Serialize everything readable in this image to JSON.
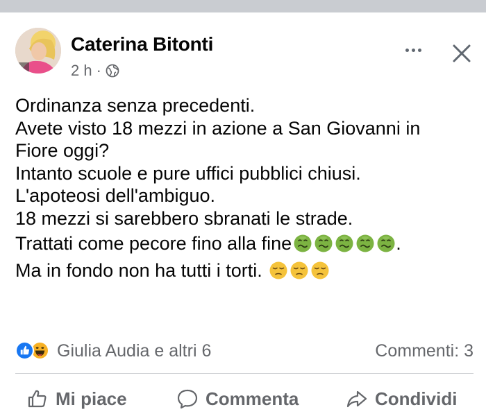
{
  "post": {
    "author": "Caterina Bitonti",
    "time": "2 h",
    "separator": "·",
    "privacy_icon": "globe-icon",
    "menu_icon": "more-options-icon",
    "close_icon": "close-icon",
    "lines": [
      "Ordinanza senza precedenti.",
      "Avete visto 18 mezzi in azione a San Giovanni in",
      "Fiore oggi?",
      "Intanto scuole e pure uffici pubblici chiusi.",
      "L'apoteosi dell'ambiguo.",
      "18 mezzi si sarebbero sbranati le strade."
    ],
    "line7_text": "Trattati come pecore fino alla fine",
    "line7_suffix": ".",
    "line7_emoji": "nauseated-face-emoji",
    "line7_emoji_count": 5,
    "line8_text": "Ma in fondo non ha tutti i torti. ",
    "line8_emoji": "pensive-face-emoji",
    "line8_emoji_count": 3
  },
  "reactions": {
    "icons": [
      "like-reaction-icon",
      "haha-reaction-icon"
    ],
    "names": "Giulia Audia e altri 6",
    "comments": "Commenti: 3"
  },
  "actions": {
    "like": "Mi piace",
    "comment": "Commenta",
    "share": "Condividi"
  },
  "colors": {
    "secondary_text": "#65676b",
    "primary_text": "#050505",
    "like_blue": "#1877f2",
    "emoji_green": "#7cb342",
    "emoji_yellow": "#f5c33b"
  }
}
